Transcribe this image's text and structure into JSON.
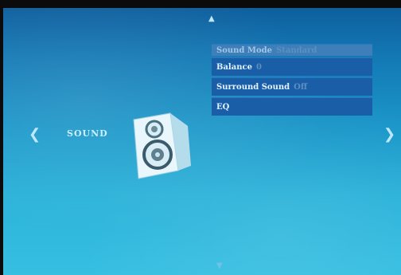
{
  "nav": {
    "up": "▲",
    "down": "▼",
    "left": "❮",
    "right": "❯"
  },
  "page": {
    "label": "SOUND",
    "icon": "speaker-icon"
  },
  "menu": {
    "items": [
      {
        "label": "Sound Mode",
        "value": "Standard"
      },
      {
        "label": "Balance",
        "value": "0"
      },
      {
        "label": "Surround Sound",
        "value": "Off"
      },
      {
        "label": "EQ",
        "value": ""
      }
    ]
  },
  "colors": {
    "background": "#1b97c9",
    "menu_item": "#1a5ea8",
    "selected_item": "#3e7fba"
  }
}
